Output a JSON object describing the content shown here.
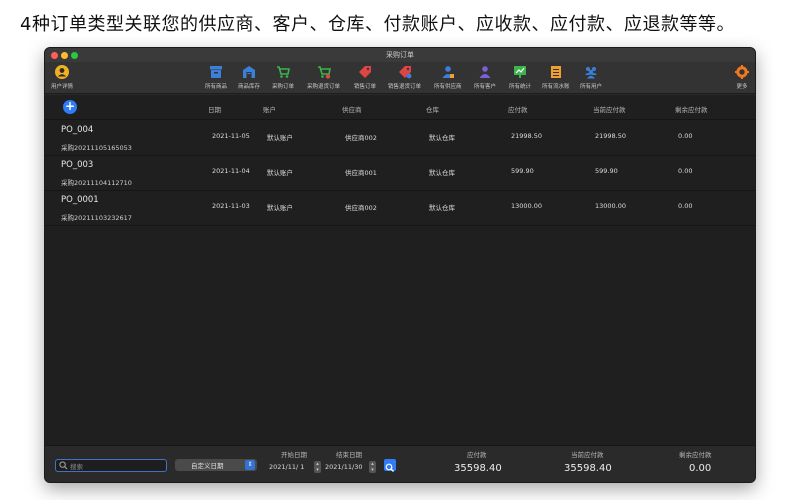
{
  "headline": "4种订单类型关联您的供应商、客户、仓库、付款账户、应收款、应付款、应退款等等。",
  "window": {
    "title": "采购订单"
  },
  "toolbar": {
    "left": {
      "label": "用户详情",
      "icon": "user-icon"
    },
    "items": [
      {
        "label": "所有商品",
        "icon": "products-icon",
        "color": "#3b7fd9"
      },
      {
        "label": "商品库存",
        "icon": "warehouse-icon",
        "color": "#3b7fd9"
      },
      {
        "label": "采购订单",
        "icon": "cart-icon",
        "color": "#3cb44b"
      },
      {
        "label": "采购退货订单",
        "icon": "cart-return-icon",
        "color": "#3cb44b"
      },
      {
        "label": "销售订单",
        "icon": "tag-icon",
        "color": "#e04545"
      },
      {
        "label": "销售退货订单",
        "icon": "tag-return-icon",
        "color": "#e04545"
      },
      {
        "label": "所有供应商",
        "icon": "supplier-icon",
        "color": "#3b7fd9"
      },
      {
        "label": "所有客户",
        "icon": "customer-icon",
        "color": "#7b5fd9"
      },
      {
        "label": "所有统计",
        "icon": "stats-icon",
        "color": "#3cb44b"
      },
      {
        "label": "所有流水账",
        "icon": "ledger-icon",
        "color": "#f0a030"
      },
      {
        "label": "所有用户",
        "icon": "users-icon",
        "color": "#3b7fd9"
      }
    ],
    "right": {
      "label": "更多",
      "icon": "gear-icon"
    }
  },
  "table": {
    "columns": [
      "日期",
      "账户",
      "供应商",
      "仓库",
      "应付款",
      "当前应付款",
      "剩余应付款"
    ],
    "rows": [
      {
        "name": "PO_004",
        "sub": "采购20211105165053",
        "date": "2021-11-05",
        "account": "默认账户",
        "supplier": "供应商002",
        "warehouse": "默认仓库",
        "payable": "21998.50",
        "current": "21998.50",
        "remaining": "0.00"
      },
      {
        "name": "PO_003",
        "sub": "采购20211104112710",
        "date": "2021-11-04",
        "account": "默认账户",
        "supplier": "供应商001",
        "warehouse": "默认仓库",
        "payable": "599.90",
        "current": "599.90",
        "remaining": "0.00"
      },
      {
        "name": "PO_0001",
        "sub": "采购20211103232617",
        "date": "2021-11-03",
        "account": "默认账户",
        "supplier": "供应商002",
        "warehouse": "默认仓库",
        "payable": "13000.00",
        "current": "13000.00",
        "remaining": "0.00"
      }
    ]
  },
  "footer": {
    "search_placeholder": "搜索",
    "date_mode": "自定义日期",
    "start_label": "开始日期",
    "end_label": "结束日期",
    "start_value": "2021/11/ 1",
    "end_value": "2021/11/30",
    "totals": [
      {
        "label": "应付款",
        "value": "35598.40"
      },
      {
        "label": "当前应付款",
        "value": "35598.40"
      },
      {
        "label": "剩余应付款",
        "value": "0.00"
      }
    ]
  },
  "colors": {
    "accent": "#2f7cf6",
    "window_bg": "#1f1f1f",
    "toolbar_bg": "#333333"
  }
}
